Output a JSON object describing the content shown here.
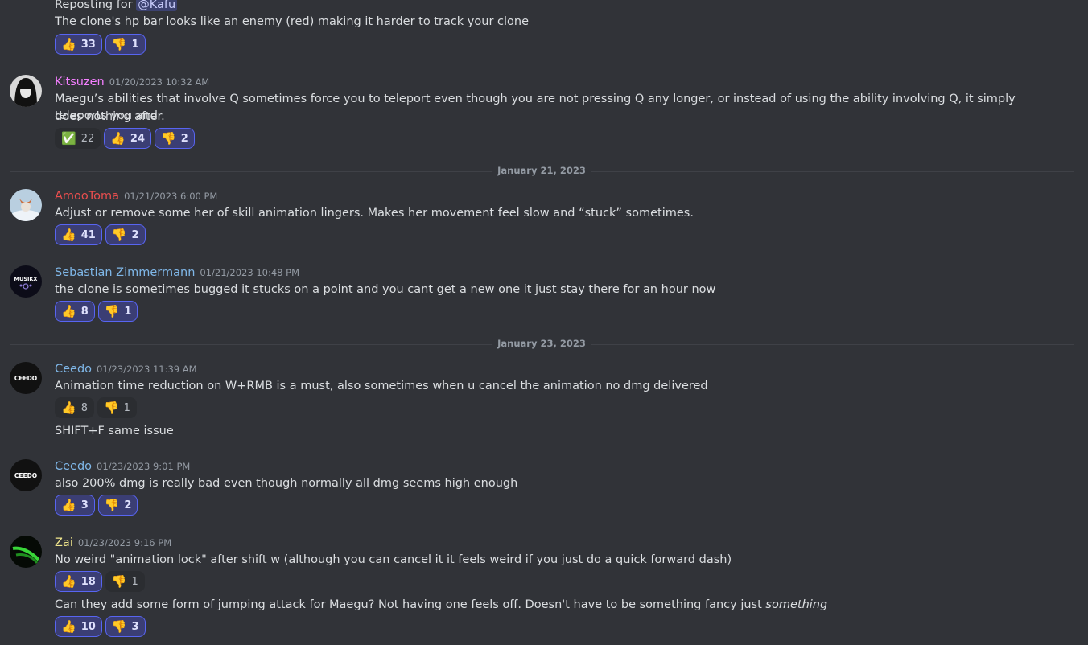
{
  "messages": [
    {
      "lines": [
        {
          "prefix": "Reposting for ",
          "mention": "@Kafu"
        },
        {
          "text": "The clone's hp bar looks like an enemy (red) making it harder to track your clone"
        }
      ],
      "reactions": [
        {
          "emoji": "👍",
          "count": "33"
        },
        {
          "emoji": "👎",
          "count": "1"
        }
      ]
    },
    {
      "author": "Kitsuzen",
      "author_color": "#f47fff",
      "timestamp": "01/20/2023 10:32 AM",
      "lines": [
        {
          "text": "Maegu’s abilities that involve Q sometimes force you to teleport even though you are not pressing Q any longer, or instead of using the ability involving Q, it simply teleports you and"
        },
        {
          "text": "does nothing after."
        }
      ],
      "reactions": [
        {
          "emoji": "✅",
          "count": "22"
        },
        {
          "emoji": "👍",
          "count": "24"
        },
        {
          "emoji": "👎",
          "count": "2"
        }
      ]
    },
    {
      "divider": "January 21, 2023"
    },
    {
      "author": "AmooToma",
      "author_color": "#e94e4e",
      "timestamp": "01/21/2023 6:00 PM",
      "lines": [
        {
          "text": "Adjust or remove some her of skill animation lingers. Makes her movement feel slow and “stuck” sometimes."
        }
      ],
      "reactions": [
        {
          "emoji": "👍",
          "count": "41"
        },
        {
          "emoji": "👎",
          "count": "2"
        }
      ]
    },
    {
      "author": "Sebastian Zimmermann",
      "author_color": "#7fb7e8",
      "timestamp": "01/21/2023 10:48 PM",
      "lines": [
        {
          "text": "the clone is sometimes bugged it stucks on a point and you cant get a new one it just stay there for an hour now"
        }
      ],
      "reactions": [
        {
          "emoji": "👍",
          "count": "8"
        },
        {
          "emoji": "👎",
          "count": "1"
        }
      ]
    },
    {
      "divider": "January 23, 2023"
    },
    {
      "author": "Ceedo",
      "author_color": "#7fb7e8",
      "timestamp": "01/23/2023 11:39 AM",
      "lines": [
        {
          "text": "Animation time reduction on W+RMB is a must, also sometimes when u cancel the animation no dmg delivered"
        }
      ],
      "reactions": [
        {
          "emoji": "👍",
          "count": "8"
        },
        {
          "emoji": "👎",
          "count": "1"
        }
      ],
      "followup": "SHIFT+F same issue"
    },
    {
      "author": "Ceedo",
      "author_color": "#7fb7e8",
      "timestamp": "01/23/2023 9:01 PM",
      "lines": [
        {
          "text": "also 200% dmg is really bad even though normally all dmg seems high enough"
        }
      ],
      "reactions": [
        {
          "emoji": "👍",
          "count": "3"
        },
        {
          "emoji": "👎",
          "count": "2"
        }
      ]
    },
    {
      "author": "Zai",
      "author_color": "#f0e68c",
      "timestamp": "01/23/2023 9:16 PM",
      "lines": [
        {
          "text": "No weird \"animation lock\" after shift w (although you can cancel it it feels weird if you just do a quick forward dash)"
        }
      ],
      "reactions": [
        {
          "emoji": "👍",
          "count": "18"
        },
        {
          "emoji": "👎",
          "count": "1"
        }
      ],
      "followup_prefix": "Can they add some form of jumping attack for Maegu? Not having one feels off.  Doesn't have to be something fancy just ",
      "followup_em": "something",
      "followup_reactions": [
        {
          "emoji": "👍",
          "count": "10"
        },
        {
          "emoji": "👎",
          "count": "3"
        }
      ]
    }
  ],
  "avatars": {
    "ceedo_text": "CEEDO",
    "sebastian_text": "MUSIKX"
  }
}
